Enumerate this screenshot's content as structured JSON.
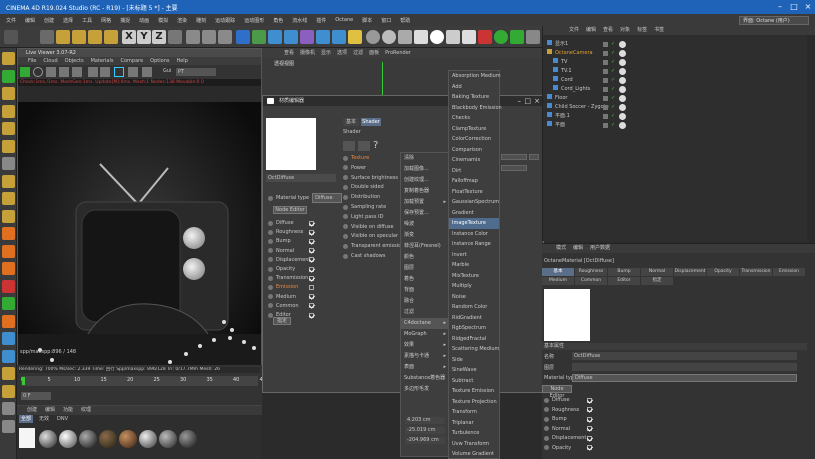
{
  "window": {
    "title": "CINEMA 4D R19.024 Studio (RC - R19) - [未标题 5 *] - 主要"
  },
  "menubar": [
    "文件",
    "编辑",
    "创建",
    "选择",
    "工具",
    "网格",
    "捕捉",
    "动画",
    "模拟",
    "渲染",
    "雕刻",
    "运动跟踪",
    "运动图形",
    "角色",
    "流水线",
    "插件",
    "Octane",
    "脚本",
    "窗口",
    "帮助"
  ],
  "layout": {
    "label": "界面:",
    "value": "Octane (用户)"
  },
  "toolbar": {
    "x": "X",
    "y": "Y",
    "z": "Z"
  },
  "live_viewer": {
    "title": "Live Viewer 3.07-R2",
    "menu": [
      "File",
      "Cloud",
      "Objects",
      "Materials",
      "Compare",
      "Options",
      "Help",
      "Gui"
    ],
    "gui_value": "PT",
    "status": "Check:1ms./1ms. MeshGen:1ms. Update[M]:0ms. Mesh:1 Nodes:138 Movable:0 0",
    "foot": "spp/maxspp:896 / 148",
    "stats": "Rendering: 700%   Ms/sec: 2.339   Time: 回行  Spp/maxspp: 896/128   Tri: 0/17.7Mm  Mesh: 26"
  },
  "timeline": {
    "ticks": [
      "0",
      "5",
      "10",
      "15",
      "20",
      "25",
      "30",
      "35",
      "40",
      "45"
    ],
    "frame": "0 F"
  },
  "mat_manager": {
    "tabs": [
      "创建",
      "编辑",
      "功能",
      "纹理"
    ],
    "filter": [
      "全部",
      "无效",
      "DNV"
    ]
  },
  "viewport": {
    "menu": [
      "查看",
      "摄像机",
      "显示",
      "选项",
      "过滤",
      "面板",
      "ProRender"
    ],
    "label": "透视视图"
  },
  "material_editor": {
    "title": "材质编辑器",
    "tabs": [
      "基本",
      "Shader"
    ],
    "shader_label": "Shader",
    "name": "OctDiffuse",
    "material_type_label": "Material type",
    "material_type_value": "Diffuse",
    "node_editor": "Node Editor",
    "channels": [
      {
        "name": "Diffuse",
        "on": true
      },
      {
        "name": "Roughness",
        "on": true
      },
      {
        "name": "Bump",
        "on": true
      },
      {
        "name": "Normal",
        "on": true
      },
      {
        "name": "Displacement",
        "on": true
      },
      {
        "name": "Opacity",
        "on": true
      },
      {
        "name": "Transmission",
        "on": true
      },
      {
        "name": "Emission",
        "on": false
      },
      {
        "name": "Medium",
        "on": true
      },
      {
        "name": "Common",
        "on": true
      },
      {
        "name": "Editor",
        "on": true
      }
    ],
    "assign": "指定",
    "props": [
      {
        "name": "Texture"
      },
      {
        "name": "Power"
      },
      {
        "name": "Surface brightness"
      },
      {
        "name": "Double sided"
      },
      {
        "name": "Distribution"
      },
      {
        "name": "Sampling rate"
      },
      {
        "name": "Light pass ID"
      },
      {
        "name": "Visible on diffuse"
      },
      {
        "name": "Visible on specular"
      },
      {
        "name": "Transparent emission"
      },
      {
        "name": "Cast shadows"
      }
    ]
  },
  "context_menu": [
    {
      "label": "清除",
      "arrow": false
    },
    {
      "label": "加载图像...",
      "arrow": false
    },
    {
      "label": "创建纹理...",
      "arrow": false
    },
    {
      "label": "复制着色器",
      "arrow": false
    },
    {
      "label": "加载预置",
      "arrow": true
    },
    {
      "label": "保存预置...",
      "arrow": false
    },
    {
      "label": "噪波",
      "arrow": false
    },
    {
      "label": "渐变",
      "arrow": false
    },
    {
      "label": "菲涅耳(Fresnel)",
      "arrow": false
    },
    {
      "label": "颜色",
      "arrow": false
    },
    {
      "label": "图层",
      "arrow": false
    },
    {
      "label": "着色",
      "arrow": false
    },
    {
      "label": "背面",
      "arrow": false
    },
    {
      "label": "融合",
      "arrow": false
    },
    {
      "label": "过滤",
      "arrow": false
    },
    {
      "label": "C4doctane",
      "arrow": true
    },
    {
      "label": "MoGraph",
      "arrow": true
    },
    {
      "label": "效果",
      "arrow": true
    },
    {
      "label": "素描与卡通",
      "arrow": true
    },
    {
      "label": "表面",
      "arrow": true
    },
    {
      "label": "Substance着色器",
      "arrow": false
    },
    {
      "label": "多边形毛发",
      "arrow": false
    }
  ],
  "context_selected": "C4doctane",
  "submenu": [
    "Absorption Medium",
    "Add",
    "Baking Texture",
    "Blackbody Emission",
    "Checks",
    "ClampTexture",
    "ColorCorrection",
    "Comparison",
    "Cinemamix",
    "Dirt",
    "Falloffmap",
    "FloatTexture",
    "GaussianSpectrum",
    "Gradient",
    "ImageTexture",
    "Instance Color",
    "Instance Range",
    "Invert",
    "Marble",
    "MixTexture",
    "Multiply",
    "Noise",
    "Random Color",
    "RidGradient",
    "RgbSpectrum",
    "RidgedFractal",
    "Scattering Medium",
    "Side",
    "SineWave",
    "Subtract",
    "Texture Emission",
    "Texture Projection",
    "Transform",
    "Triplanar",
    "Turbulence",
    "Uvw Transform",
    "Volume Gradient"
  ],
  "submenu_highlight": "ImageTexture",
  "coords": {
    "x": "4.203 cm",
    "y": "-25.019 cm",
    "z": "-204.969 cm"
  },
  "object_manager": {
    "menu": [
      "文件",
      "编辑",
      "查看",
      "对象",
      "标签",
      "书签"
    ],
    "objects": [
      "显示1",
      "OctaneCamera",
      "TV",
      "TV.1",
      "Cord",
      "Cord_Lights",
      "Floor",
      "Child Soccer - Zygote",
      "平面.1",
      "平面"
    ]
  },
  "attributes": {
    "menu": [
      "模式",
      "编辑",
      "用户数据"
    ],
    "title": "OctaneMaterial [OctDiffuse]",
    "tabs": [
      "基本",
      "Roughness",
      "Bump",
      "Normal",
      "Displacement",
      "Opacity",
      "Transmission",
      "Emission",
      "Medium",
      "Common",
      "Editor",
      "指定"
    ],
    "section": "基本属性",
    "name_label": "名称",
    "name_value": "OctDiffuse",
    "layer_label": "图层",
    "type_label": "Material type",
    "type_value": "Diffuse",
    "node_editor": "Node Editor",
    "checks": [
      "Diffuse",
      "Roughness",
      "Bump",
      "Normal",
      "Displacement",
      "Opacity"
    ]
  }
}
